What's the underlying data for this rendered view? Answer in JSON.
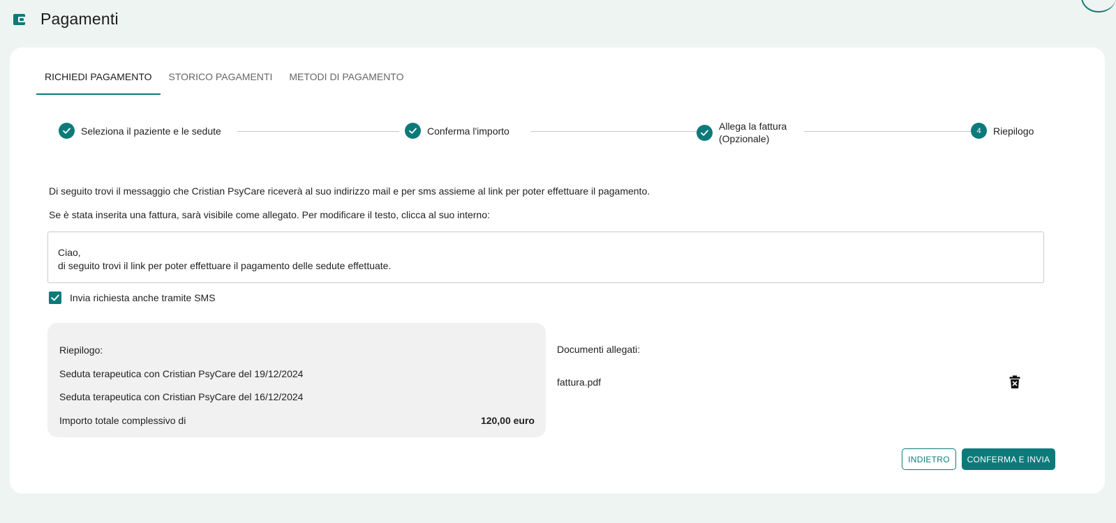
{
  "page": {
    "title": "Pagamenti"
  },
  "colors": {
    "accent": "#0d7a7a",
    "background": "#eef4f1",
    "summary_bg": "#f1f1f1"
  },
  "tabs": [
    {
      "label": "RICHIEDI PAGAMENTO",
      "active": true
    },
    {
      "label": "STORICO PAGAMENTI",
      "active": false
    },
    {
      "label": "METODI DI PAGAMENTO",
      "active": false
    }
  ],
  "stepper": {
    "steps": [
      {
        "label": "Seleziona il paziente e le sedute",
        "state": "done",
        "icon": "check-icon"
      },
      {
        "label": "Conferma l'importo",
        "state": "done",
        "icon": "check-icon"
      },
      {
        "label_line1": "Allega la fattura",
        "label_line2": "(Opzionale)",
        "state": "done",
        "icon": "check-icon"
      },
      {
        "number": "4",
        "label": "Riepilogo",
        "state": "current"
      }
    ]
  },
  "intro": {
    "line1": "Di seguito trovi il messaggio che Cristian PsyCare riceverà al suo indirizzo mail e per sms assieme al link per poter effettuare il pagamento.",
    "line2": "Se è stata inserita una fattura, sarà visibile come allegato. Per modificare il testo, clicca al suo interno:"
  },
  "message": {
    "line1": "Ciao,",
    "line2": "di seguito trovi il link per poter effettuare il pagamento delle sedute effettuate."
  },
  "sms": {
    "label": "Invia richiesta anche tramite SMS",
    "checked": true
  },
  "summary": {
    "title": "Riepilogo:",
    "items": [
      "Seduta terapeutica con Cristian PsyCare del 19/12/2024",
      "Seduta terapeutica con Cristian PsyCare del 16/12/2024"
    ],
    "total_label": "Importo totale complessivo di",
    "total_value": "120,00 euro"
  },
  "documents": {
    "title": "Documenti allegati:",
    "files": [
      {
        "name": "fattura.pdf"
      }
    ]
  },
  "actions": {
    "back_label": "INDIETRO",
    "confirm_label": "CONFERMA E INVIA"
  }
}
